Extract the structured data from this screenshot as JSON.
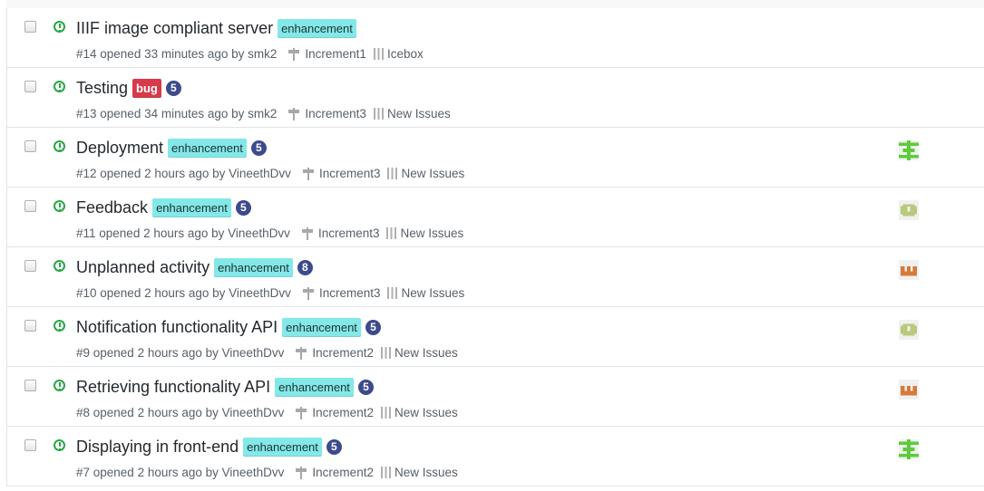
{
  "issues": [
    {
      "title": "IIIF image compliant server",
      "labels": [
        {
          "text": "enhancement",
          "type": "enh"
        }
      ],
      "count": "",
      "number_text": "#14 opened 33 minutes ago by smk2",
      "milestone": "Increment1",
      "project": "Icebox",
      "avatar": ""
    },
    {
      "title": "Testing",
      "labels": [
        {
          "text": "bug",
          "type": "bug"
        }
      ],
      "count": "5",
      "number_text": "#13 opened 34 minutes ago by smk2",
      "milestone": "Increment3",
      "project": "New Issues",
      "avatar": ""
    },
    {
      "title": "Deployment",
      "labels": [
        {
          "text": "enhancement",
          "type": "enh"
        }
      ],
      "count": "5",
      "number_text": "#12 opened 2 hours ago by VineethDvv",
      "milestone": "Increment3",
      "project": "New Issues",
      "avatar": "green-identicon"
    },
    {
      "title": "Feedback",
      "labels": [
        {
          "text": "enhancement",
          "type": "enh"
        }
      ],
      "count": "5",
      "number_text": "#11 opened 2 hours ago by VineethDvv",
      "milestone": "Increment3",
      "project": "New Issues",
      "avatar": "olive-identicon"
    },
    {
      "title": "Unplanned activity",
      "labels": [
        {
          "text": "enhancement",
          "type": "enh"
        }
      ],
      "count": "8",
      "number_text": "#10 opened 2 hours ago by VineethDvv",
      "milestone": "Increment3",
      "project": "New Issues",
      "avatar": "orange-identicon"
    },
    {
      "title": "Notification functionality API",
      "labels": [
        {
          "text": "enhancement",
          "type": "enh"
        }
      ],
      "count": "5",
      "number_text": "#9 opened 2 hours ago by VineethDvv",
      "milestone": "Increment2",
      "project": "New Issues",
      "avatar": "olive-identicon"
    },
    {
      "title": "Retrieving functionality API",
      "labels": [
        {
          "text": "enhancement",
          "type": "enh"
        }
      ],
      "count": "5",
      "number_text": "#8 opened 2 hours ago by VineethDvv",
      "milestone": "Increment2",
      "project": "New Issues",
      "avatar": "orange-identicon"
    },
    {
      "title": "Displaying in front-end",
      "labels": [
        {
          "text": "enhancement",
          "type": "enh"
        }
      ],
      "count": "5",
      "number_text": "#7 opened 2 hours ago by VineethDvv",
      "milestone": "Increment2",
      "project": "New Issues",
      "avatar": "green-identicon"
    }
  ],
  "colors": {
    "open": "#28a745",
    "enhancement": "#84e8e8",
    "bug": "#d73a4a",
    "count": "#3d4a8c"
  }
}
